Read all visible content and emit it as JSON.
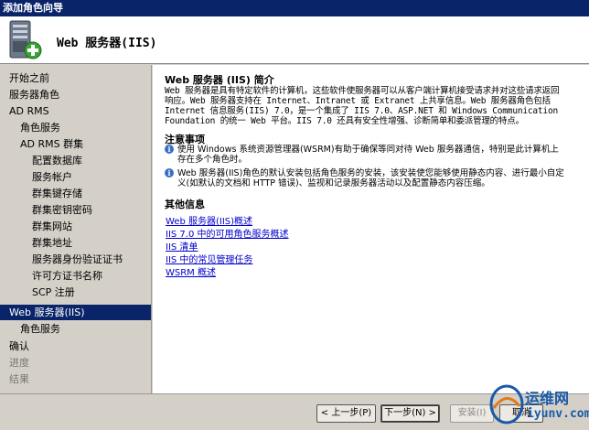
{
  "window": {
    "title": "添加角色向导"
  },
  "header": {
    "title": "Web 服务器(IIS)"
  },
  "sidebar": {
    "items": [
      {
        "label": "开始之前",
        "state": "normal"
      },
      {
        "label": "服务器角色",
        "state": "normal"
      },
      {
        "label": "AD RMS",
        "state": "normal"
      },
      {
        "label": "角色服务",
        "state": "normal"
      },
      {
        "label": "AD RMS 群集",
        "state": "normal"
      },
      {
        "label": "配置数据库",
        "state": "normal"
      },
      {
        "label": "服务帐户",
        "state": "normal"
      },
      {
        "label": "群集键存储",
        "state": "normal"
      },
      {
        "label": "群集密钥密码",
        "state": "normal"
      },
      {
        "label": "群集网站",
        "state": "normal"
      },
      {
        "label": "群集地址",
        "state": "normal"
      },
      {
        "label": "服务器身份验证证书",
        "state": "normal"
      },
      {
        "label": "许可方证书名称",
        "state": "normal"
      },
      {
        "label": "SCP 注册",
        "state": "normal"
      },
      {
        "label": "Web 服务器(IIS)",
        "state": "active"
      },
      {
        "label": "角色服务",
        "state": "normal"
      },
      {
        "label": "确认",
        "state": "normal"
      },
      {
        "label": "进度",
        "state": "disabled"
      },
      {
        "label": "结果",
        "state": "disabled"
      }
    ]
  },
  "content": {
    "intro_title": "Web 服务器 (IIS) 简介",
    "intro_text": "Web 服务器是具有特定软件的计算机，这些软件使服务器可以从客户端计算机接受请求并对这些请求返回响应。Web 服务器支持在 Internet、Intranet 或 Extranet 上共享信息。Web 服务器角色包括 Internet 信息服务(IIS) 7.0，是一个集成了 IIS 7.0、ASP.NET 和 Windows Communication Foundation 的统一 Web 平台。IIS 7.0 还具有安全性增强、诊断简单和委派管理的特点。",
    "notes_title": "注意事项",
    "notes": [
      "使用 Windows 系统资源管理器(WSRM)有助于确保等同对待 Web 服务器通信，特别是此计算机上存在多个角色时。",
      "Web 服务器(IIS)角色的默认安装包括角色服务的安装，该安装使您能够使用静态内容、进行最小自定义(如默认的文档和 HTTP 错误)、监视和记录服务器活动以及配置静态内容压缩。"
    ],
    "more_title": "其他信息",
    "links": [
      "Web 服务器(IIS)概述",
      "IIS 7.0 中的可用角色服务概述",
      "IIS 清单",
      "IIS 中的常见管理任务",
      "WSRM 概述"
    ]
  },
  "footer": {
    "prev_label": "< 上一步(P)",
    "next_label": "下一步(N) >",
    "install_label": "安装(I)",
    "cancel_label": "取消"
  },
  "watermark": {
    "text": "运维网",
    "url": "iyunv.com"
  },
  "colors": {
    "titlebar": "#0a246a",
    "active_nav": "#0a246a",
    "link": "#0000cc"
  }
}
